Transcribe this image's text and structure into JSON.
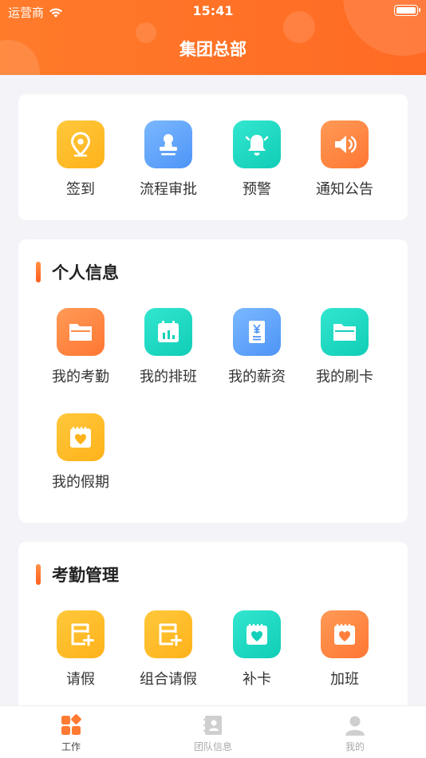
{
  "status_bar": {
    "carrier": "运营商",
    "time": "15:41"
  },
  "header": {
    "title": "集团总部"
  },
  "quick_actions": [
    {
      "label": "签到",
      "icon": "location-pin-icon"
    },
    {
      "label": "流程审批",
      "icon": "stamp-icon"
    },
    {
      "label": "预警",
      "icon": "alarm-bell-icon"
    },
    {
      "label": "通知公告",
      "icon": "speaker-icon"
    }
  ],
  "personal": {
    "title": "个人信息",
    "items": [
      {
        "label": "我的考勤",
        "icon": "folder-icon"
      },
      {
        "label": "我的排班",
        "icon": "calendar-chart-icon"
      },
      {
        "label": "我的薪资",
        "icon": "salary-document-icon"
      },
      {
        "label": "我的刷卡",
        "icon": "folder-icon"
      },
      {
        "label": "我的假期",
        "icon": "calendar-heart-icon"
      }
    ]
  },
  "attendance": {
    "title": "考勤管理",
    "items": [
      {
        "label": "请假",
        "icon": "leave-form-icon"
      },
      {
        "label": "组合请假",
        "icon": "leave-form-icon"
      },
      {
        "label": "补卡",
        "icon": "calendar-heart-icon"
      },
      {
        "label": "加班",
        "icon": "calendar-heart-icon"
      }
    ]
  },
  "tabs": [
    {
      "label": "工作",
      "icon": "grid-apps-icon",
      "active": true
    },
    {
      "label": "团队信息",
      "icon": "contacts-book-icon",
      "active": false
    },
    {
      "label": "我的",
      "icon": "person-icon",
      "active": false
    }
  ],
  "colors": {
    "brand": "#ff6a24",
    "teal": "#10cdb7",
    "blue": "#4e94f7",
    "yellow": "#ffb21a"
  }
}
